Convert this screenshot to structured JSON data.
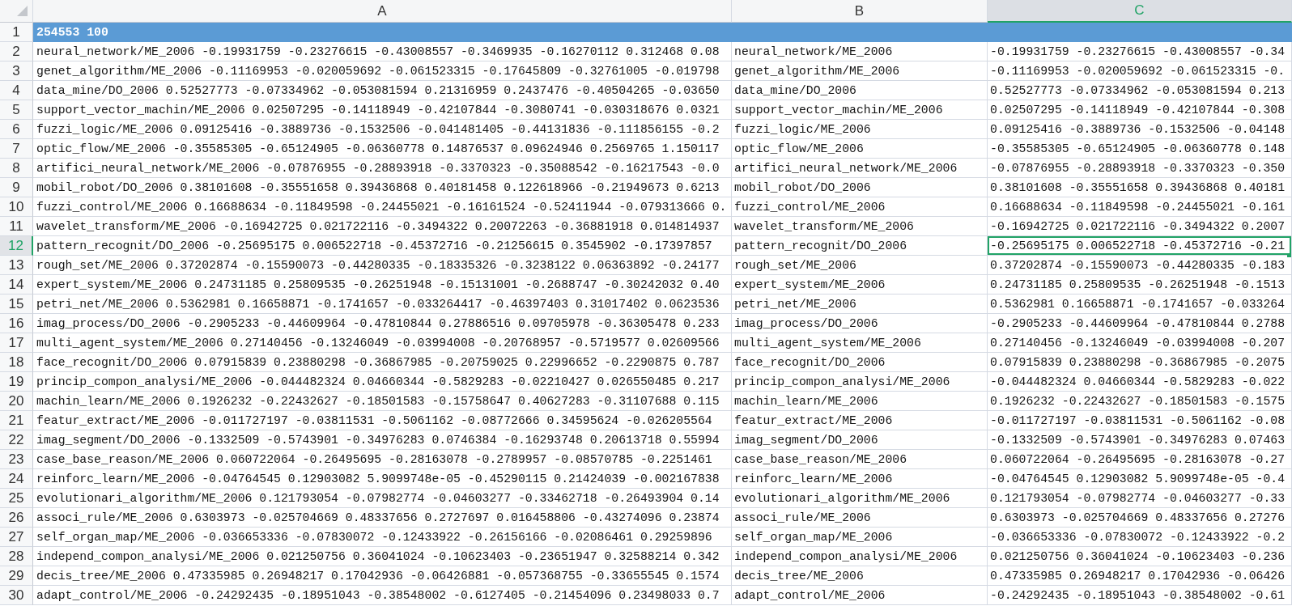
{
  "columns": [
    {
      "label": "A",
      "selected": false
    },
    {
      "label": "B",
      "selected": false
    },
    {
      "label": "C",
      "selected": true
    }
  ],
  "rows": [
    {
      "number": "1",
      "selected": false,
      "filled": true,
      "cells": [
        "254553 100"
      ]
    },
    {
      "number": "2",
      "selected": false,
      "filled": false,
      "cells": [
        "neural_network/ME_2006 -0.19931759 -0.23276615 -0.43008557 -0.3469935 -0.16270112 0.312468 0.08",
        "neural_network/ME_2006",
        "-0.19931759 -0.23276615 -0.43008557 -0.34"
      ]
    },
    {
      "number": "3",
      "selected": false,
      "filled": false,
      "cells": [
        "genet_algorithm/ME_2006 -0.11169953 -0.020059692 -0.061523315 -0.17645809 -0.32761005 -0.019798",
        "genet_algorithm/ME_2006",
        "-0.11169953 -0.020059692 -0.061523315 -0."
      ]
    },
    {
      "number": "4",
      "selected": false,
      "filled": false,
      "cells": [
        "data_mine/DO_2006 0.52527773 -0.07334962 -0.053081594 0.21316959 0.2437476 -0.40504265 -0.03650",
        "data_mine/DO_2006",
        "0.52527773 -0.07334962 -0.053081594 0.213"
      ]
    },
    {
      "number": "5",
      "selected": false,
      "filled": false,
      "cells": [
        "support_vector_machin/ME_2006 0.02507295 -0.14118949 -0.42107844 -0.3080741 -0.030318676 0.0321",
        "support_vector_machin/ME_2006",
        "0.02507295 -0.14118949 -0.42107844 -0.308"
      ]
    },
    {
      "number": "6",
      "selected": false,
      "filled": false,
      "cells": [
        "fuzzi_logic/ME_2006 0.09125416 -0.3889736 -0.1532506 -0.041481405 -0.44131836 -0.111856155 -0.2",
        "fuzzi_logic/ME_2006",
        "0.09125416 -0.3889736 -0.1532506 -0.04148"
      ]
    },
    {
      "number": "7",
      "selected": false,
      "filled": false,
      "cells": [
        "optic_flow/ME_2006 -0.35585305 -0.65124905 -0.06360778 0.14876537 0.09624946 0.2569765 1.150117",
        "optic_flow/ME_2006",
        "-0.35585305 -0.65124905 -0.06360778 0.148"
      ]
    },
    {
      "number": "8",
      "selected": false,
      "filled": false,
      "cells": [
        "artifici_neural_network/ME_2006 -0.07876955 -0.28893918 -0.3370323 -0.35088542 -0.16217543 -0.0",
        "artifici_neural_network/ME_2006",
        "-0.07876955 -0.28893918 -0.3370323 -0.350"
      ]
    },
    {
      "number": "9",
      "selected": false,
      "filled": false,
      "cells": [
        "mobil_robot/DO_2006 0.38101608 -0.35551658 0.39436868 0.40181458 0.122618966 -0.21949673 0.6213",
        "mobil_robot/DO_2006",
        "0.38101608 -0.35551658 0.39436868 0.40181"
      ]
    },
    {
      "number": "10",
      "selected": false,
      "filled": false,
      "cells": [
        "fuzzi_control/ME_2006 0.16688634 -0.11849598 -0.24455021 -0.16161524 -0.52411944 -0.079313666 0.",
        "fuzzi_control/ME_2006",
        "0.16688634 -0.11849598 -0.24455021 -0.161"
      ]
    },
    {
      "number": "11",
      "selected": false,
      "filled": false,
      "cells": [
        "wavelet_transform/ME_2006 -0.16942725 0.021722116 -0.3494322 0.20072263 -0.36881918 0.014814937",
        "wavelet_transform/ME_2006",
        "-0.16942725 0.021722116 -0.3494322 0.2007"
      ]
    },
    {
      "number": "12",
      "selected": true,
      "filled": false,
      "cells": [
        "pattern_recognit/DO_2006 -0.25695175 0.006522718 -0.45372716 -0.21256615 0.3545902 -0.17397857",
        "pattern_recognit/DO_2006",
        "-0.25695175 0.006522718 -0.45372716 -0.21"
      ]
    },
    {
      "number": "13",
      "selected": false,
      "filled": false,
      "cells": [
        "rough_set/ME_2006 0.37202874 -0.15590073 -0.44280335 -0.18335326 -0.3238122 0.06363892 -0.24177",
        "rough_set/ME_2006",
        "0.37202874 -0.15590073 -0.44280335 -0.183"
      ]
    },
    {
      "number": "14",
      "selected": false,
      "filled": false,
      "cells": [
        "expert_system/ME_2006 0.24731185 0.25809535 -0.26251948 -0.15131001 -0.2688747 -0.30242032 0.40",
        "expert_system/ME_2006",
        "0.24731185 0.25809535 -0.26251948 -0.1513"
      ]
    },
    {
      "number": "15",
      "selected": false,
      "filled": false,
      "cells": [
        "petri_net/ME_2006 0.5362981 0.16658871 -0.1741657 -0.033264417 -0.46397403 0.31017402 0.0623536",
        "petri_net/ME_2006",
        "0.5362981 0.16658871 -0.1741657 -0.033264"
      ]
    },
    {
      "number": "16",
      "selected": false,
      "filled": false,
      "cells": [
        "imag_process/DO_2006 -0.2905233 -0.44609964 -0.47810844 0.27886516 0.09705978 -0.36305478 0.233",
        "imag_process/DO_2006",
        "-0.2905233 -0.44609964 -0.47810844 0.2788"
      ]
    },
    {
      "number": "17",
      "selected": false,
      "filled": false,
      "cells": [
        "multi_agent_system/ME_2006 0.27140456 -0.13246049 -0.03994008 -0.20768957 -0.5719577 0.02609566",
        "multi_agent_system/ME_2006",
        "0.27140456 -0.13246049 -0.03994008 -0.207"
      ]
    },
    {
      "number": "18",
      "selected": false,
      "filled": false,
      "cells": [
        "face_recognit/DO_2006 0.07915839 0.23880298 -0.36867985 -0.20759025 0.22996652 -0.2290875 0.787",
        "face_recognit/DO_2006",
        "0.07915839 0.23880298 -0.36867985 -0.2075"
      ]
    },
    {
      "number": "19",
      "selected": false,
      "filled": false,
      "cells": [
        "princip_compon_analysi/ME_2006 -0.044482324 0.04660344 -0.5829283 -0.02210427 0.026550485 0.217",
        "princip_compon_analysi/ME_2006",
        "-0.044482324 0.04660344 -0.5829283 -0.022"
      ]
    },
    {
      "number": "20",
      "selected": false,
      "filled": false,
      "cells": [
        "machin_learn/ME_2006 0.1926232 -0.22432627 -0.18501583 -0.15758647 0.40627283 -0.31107688 0.115",
        "machin_learn/ME_2006",
        "0.1926232 -0.22432627 -0.18501583 -0.1575"
      ]
    },
    {
      "number": "21",
      "selected": false,
      "filled": false,
      "cells": [
        "featur_extract/ME_2006 -0.011727197 -0.03811531 -0.5061162 -0.08772666 0.34595624 -0.026205564",
        "featur_extract/ME_2006",
        "-0.011727197 -0.03811531 -0.5061162 -0.08"
      ]
    },
    {
      "number": "22",
      "selected": false,
      "filled": false,
      "cells": [
        "imag_segment/DO_2006 -0.1332509 -0.5743901 -0.34976283 0.0746384 -0.16293748 0.20613718 0.55994",
        "imag_segment/DO_2006",
        "-0.1332509 -0.5743901 -0.34976283 0.07463"
      ]
    },
    {
      "number": "23",
      "selected": false,
      "filled": false,
      "cells": [
        "case_base_reason/ME_2006 0.060722064 -0.26495695 -0.28163078 -0.2789957 -0.08570785 -0.2251461",
        "case_base_reason/ME_2006",
        "0.060722064 -0.26495695 -0.28163078 -0.27"
      ]
    },
    {
      "number": "24",
      "selected": false,
      "filled": false,
      "cells": [
        "reinforc_learn/ME_2006 -0.04764545 0.12903082 5.9099748e-05 -0.45290115 0.21424039 -0.002167838",
        "reinforc_learn/ME_2006",
        "-0.04764545 0.12903082 5.9099748e-05 -0.4"
      ]
    },
    {
      "number": "25",
      "selected": false,
      "filled": false,
      "cells": [
        "evolutionari_algorithm/ME_2006 0.121793054 -0.07982774 -0.04603277 -0.33462718 -0.26493904 0.14",
        "evolutionari_algorithm/ME_2006",
        "0.121793054 -0.07982774 -0.04603277 -0.33"
      ]
    },
    {
      "number": "26",
      "selected": false,
      "filled": false,
      "cells": [
        "associ_rule/ME_2006 0.6303973 -0.025704669 0.48337656 0.2727697 0.016458806 -0.43274096 0.23874",
        "associ_rule/ME_2006",
        "0.6303973 -0.025704669 0.48337656 0.27276"
      ]
    },
    {
      "number": "27",
      "selected": false,
      "filled": false,
      "cells": [
        "self_organ_map/ME_2006 -0.036653336 -0.07830072 -0.12433922 -0.26156166 -0.02086461 0.29259896",
        "self_organ_map/ME_2006",
        "-0.036653336 -0.07830072 -0.12433922 -0.2"
      ]
    },
    {
      "number": "28",
      "selected": false,
      "filled": false,
      "cells": [
        "independ_compon_analysi/ME_2006 0.021250756 0.36041024 -0.10623403 -0.23651947 0.32588214 0.342",
        "independ_compon_analysi/ME_2006",
        "0.021250756 0.36041024 -0.10623403 -0.236"
      ]
    },
    {
      "number": "29",
      "selected": false,
      "filled": false,
      "cells": [
        "decis_tree/ME_2006 0.47335985 0.26948217 0.17042936 -0.06426881 -0.057368755 -0.33655545 0.1574",
        "decis_tree/ME_2006",
        "0.47335985 0.26948217 0.17042936 -0.06426"
      ]
    },
    {
      "number": "30",
      "selected": false,
      "filled": false,
      "cells": [
        "adapt_control/ME_2006 -0.24292435 -0.18951043 -0.38548002 -0.6127405 -0.21454096 0.23498033 0.7",
        "adapt_control/ME_2006",
        "-0.24292435 -0.18951043 -0.38548002 -0.61"
      ]
    }
  ]
}
